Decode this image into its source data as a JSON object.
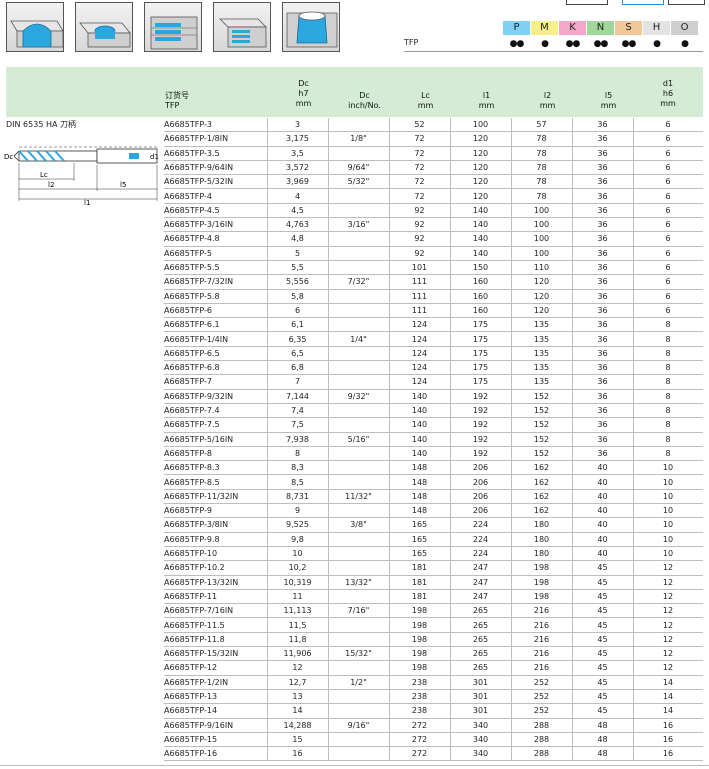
{
  "icons": [
    {
      "name": "slot-milling-icon"
    },
    {
      "name": "pocket-milling-icon"
    },
    {
      "name": "step-drilling-icon"
    },
    {
      "name": "layer-drilling-icon"
    },
    {
      "name": "blind-hole-icon"
    }
  ],
  "material": {
    "row_label": "TFP",
    "headers": [
      {
        "code": "P",
        "color": "#7fd0f2"
      },
      {
        "code": "M",
        "color": "#f7ef8a"
      },
      {
        "code": "K",
        "color": "#f4a7c6"
      },
      {
        "code": "N",
        "color": "#9fd89a"
      },
      {
        "code": "S",
        "color": "#f2c89a"
      },
      {
        "code": "H",
        "color": "#e3e3e3"
      },
      {
        "code": "O",
        "color": "#cfcfcf"
      }
    ],
    "values": [
      "●●",
      "●",
      "●●",
      "●●",
      "●●",
      "●",
      "●"
    ]
  },
  "table": {
    "headers": {
      "order_no": "订货号",
      "order_sub": "TFP",
      "dc_top": "Dc",
      "dc_mid": "h7",
      "dc_unit": "mm",
      "inch_top": "Dc",
      "inch_unit": "inch/No.",
      "lc_top": "Lc",
      "lc_unit": "mm",
      "l1_top": "l1",
      "l1_unit": "mm",
      "l2_top": "l2",
      "l2_unit": "mm",
      "l5_top": "l5",
      "l5_unit": "mm",
      "d1_top": "d1",
      "d1_mid": "h6",
      "d1_unit": "mm"
    },
    "left_title": "DIN 6535 HA 刀柄",
    "drawing_labels": {
      "dc": "Dc",
      "d1": "d1",
      "lc": "Lc",
      "l2": "l2",
      "l5": "l5",
      "l1": "l1"
    },
    "rows": [
      [
        "A6685TFP-3",
        "3",
        "",
        "52",
        "100",
        "57",
        "36",
        "6"
      ],
      [
        "A6685TFP-1/8IN",
        "3,175",
        "1/8\"",
        "72",
        "120",
        "78",
        "36",
        "6"
      ],
      [
        "A6685TFP-3.5",
        "3,5",
        "",
        "72",
        "120",
        "78",
        "36",
        "6"
      ],
      [
        "A6685TFP-9/64IN",
        "3,572",
        "9/64\"",
        "72",
        "120",
        "78",
        "36",
        "6"
      ],
      [
        "A6685TFP-5/32IN",
        "3,969",
        "5/32\"",
        "72",
        "120",
        "78",
        "36",
        "6"
      ],
      [
        "A6685TFP-4",
        "4",
        "",
        "72",
        "120",
        "78",
        "36",
        "6"
      ],
      [
        "A6685TFP-4.5",
        "4,5",
        "",
        "92",
        "140",
        "100",
        "36",
        "6"
      ],
      [
        "A6685TFP-3/16IN",
        "4,763",
        "3/16\"",
        "92",
        "140",
        "100",
        "36",
        "6"
      ],
      [
        "A6685TFP-4.8",
        "4,8",
        "",
        "92",
        "140",
        "100",
        "36",
        "6"
      ],
      [
        "A6685TFP-5",
        "5",
        "",
        "92",
        "140",
        "100",
        "36",
        "6"
      ],
      [
        "A6685TFP-5.5",
        "5,5",
        "",
        "101",
        "150",
        "110",
        "36",
        "6"
      ],
      [
        "A6685TFP-7/32IN",
        "5,556",
        "7/32\"",
        "111",
        "160",
        "120",
        "36",
        "6"
      ],
      [
        "A6685TFP-5.8",
        "5,8",
        "",
        "111",
        "160",
        "120",
        "36",
        "6"
      ],
      [
        "A6685TFP-6",
        "6",
        "",
        "111",
        "160",
        "120",
        "36",
        "6"
      ],
      [
        "A6685TFP-6.1",
        "6,1",
        "",
        "124",
        "175",
        "135",
        "36",
        "8"
      ],
      [
        "A6685TFP-1/4IN",
        "6,35",
        "1/4\"",
        "124",
        "175",
        "135",
        "36",
        "8"
      ],
      [
        "A6685TFP-6.5",
        "6,5",
        "",
        "124",
        "175",
        "135",
        "36",
        "8"
      ],
      [
        "A6685TFP-6.8",
        "6,8",
        "",
        "124",
        "175",
        "135",
        "36",
        "8"
      ],
      [
        "A6685TFP-7",
        "7",
        "",
        "124",
        "175",
        "135",
        "36",
        "8"
      ],
      [
        "A6685TFP-9/32IN",
        "7,144",
        "9/32\"",
        "140",
        "192",
        "152",
        "36",
        "8"
      ],
      [
        "A6685TFP-7.4",
        "7,4",
        "",
        "140",
        "192",
        "152",
        "36",
        "8"
      ],
      [
        "A6685TFP-7.5",
        "7,5",
        "",
        "140",
        "192",
        "152",
        "36",
        "8"
      ],
      [
        "A6685TFP-5/16IN",
        "7,938",
        "5/16\"",
        "140",
        "192",
        "152",
        "36",
        "8"
      ],
      [
        "A6685TFP-8",
        "8",
        "",
        "140",
        "192",
        "152",
        "36",
        "8"
      ],
      [
        "A6685TFP-8.3",
        "8,3",
        "",
        "148",
        "206",
        "162",
        "40",
        "10"
      ],
      [
        "A6685TFP-8.5",
        "8,5",
        "",
        "148",
        "206",
        "162",
        "40",
        "10"
      ],
      [
        "A6685TFP-11/32IN",
        "8,731",
        "11/32\"",
        "148",
        "206",
        "162",
        "40",
        "10"
      ],
      [
        "A6685TFP-9",
        "9",
        "",
        "148",
        "206",
        "162",
        "40",
        "10"
      ],
      [
        "A6685TFP-3/8IN",
        "9,525",
        "3/8\"",
        "165",
        "224",
        "180",
        "40",
        "10"
      ],
      [
        "A6685TFP-9.8",
        "9,8",
        "",
        "165",
        "224",
        "180",
        "40",
        "10"
      ],
      [
        "A6685TFP-10",
        "10",
        "",
        "165",
        "224",
        "180",
        "40",
        "10"
      ],
      [
        "A6685TFP-10.2",
        "10,2",
        "",
        "181",
        "247",
        "198",
        "45",
        "12"
      ],
      [
        "A6685TFP-13/32IN",
        "10,319",
        "13/32\"",
        "181",
        "247",
        "198",
        "45",
        "12"
      ],
      [
        "A6685TFP-11",
        "11",
        "",
        "181",
        "247",
        "198",
        "45",
        "12"
      ],
      [
        "A6685TFP-7/16IN",
        "11,113",
        "7/16\"",
        "198",
        "265",
        "216",
        "45",
        "12"
      ],
      [
        "A6685TFP-11.5",
        "11,5",
        "",
        "198",
        "265",
        "216",
        "45",
        "12"
      ],
      [
        "A6685TFP-11.8",
        "11,8",
        "",
        "198",
        "265",
        "216",
        "45",
        "12"
      ],
      [
        "A6685TFP-15/32IN",
        "11,906",
        "15/32\"",
        "198",
        "265",
        "216",
        "45",
        "12"
      ],
      [
        "A6685TFP-12",
        "12",
        "",
        "198",
        "265",
        "216",
        "45",
        "12"
      ],
      [
        "A6685TFP-1/2IN",
        "12,7",
        "1/2\"",
        "238",
        "301",
        "252",
        "45",
        "14"
      ],
      [
        "A6685TFP-13",
        "13",
        "",
        "238",
        "301",
        "252",
        "45",
        "14"
      ],
      [
        "A6685TFP-14",
        "14",
        "",
        "238",
        "301",
        "252",
        "45",
        "14"
      ],
      [
        "A6685TFP-9/16IN",
        "14,288",
        "9/16\"",
        "272",
        "340",
        "288",
        "48",
        "16"
      ],
      [
        "A6685TFP-15",
        "15",
        "",
        "272",
        "340",
        "288",
        "48",
        "16"
      ],
      [
        "A6685TFP-16",
        "16",
        "",
        "272",
        "340",
        "288",
        "48",
        "16"
      ]
    ]
  }
}
